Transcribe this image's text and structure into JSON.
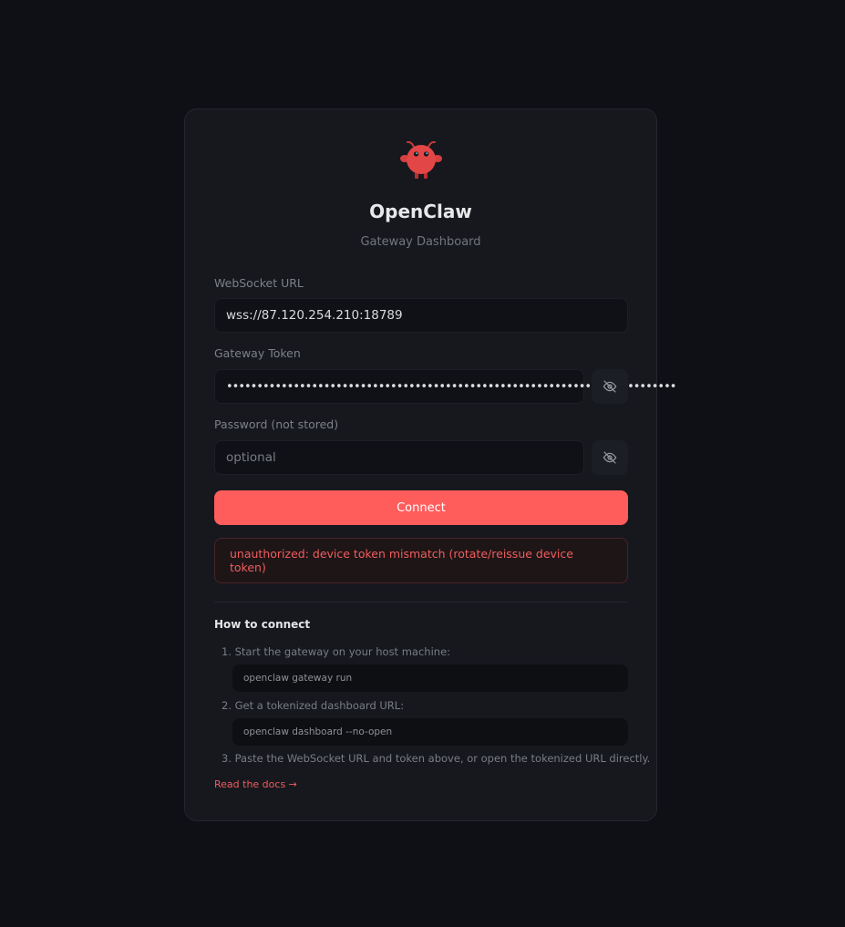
{
  "app": {
    "title": "OpenClaw",
    "subtitle": "Gateway Dashboard"
  },
  "form": {
    "websocket_label": "WebSocket URL",
    "websocket_value": "wss://87.120.254.210:18789",
    "token_label": "Gateway Token",
    "token_value": "••••••••••••••••••••••••••••••••••••••••••••••••••••••••••••••••••••••••••",
    "password_label": "Password (not stored)",
    "password_placeholder": "optional",
    "connect_label": "Connect"
  },
  "error": {
    "message": "unauthorized: device token mismatch (rotate/reissue device token)"
  },
  "howto": {
    "title": "How to connect",
    "steps": [
      "1. Start the gateway on your host machine:",
      "2. Get a tokenized dashboard URL:",
      "3. Paste the WebSocket URL and token above, or open the tokenized URL directly."
    ],
    "commands": [
      "openclaw gateway run",
      "openclaw dashboard --no-open"
    ],
    "docs_link": "Read the docs →"
  },
  "icons": {
    "logo": "lobster-mascot-icon",
    "token_toggle": "eye-off-icon",
    "password_toggle": "eye-off-icon"
  },
  "colors": {
    "accent": "#ff5c5c",
    "error": "#ef5d5d",
    "background": "#0e1015",
    "card": "#16181e"
  }
}
